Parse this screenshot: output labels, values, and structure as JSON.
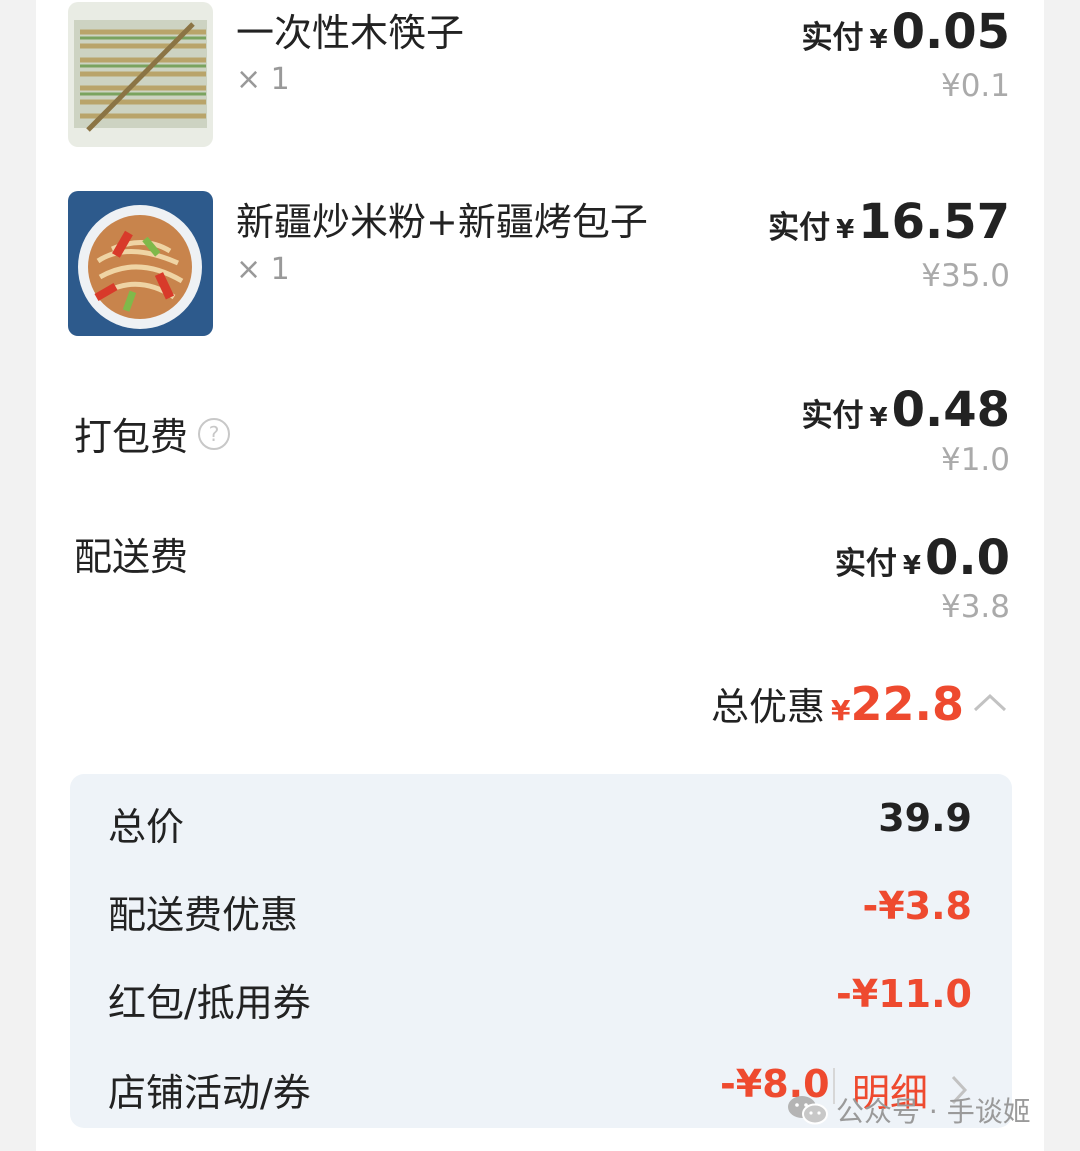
{
  "items": [
    {
      "name": "一次性木筷子",
      "quantity": "× 1",
      "paid_label": "实付",
      "currency": "¥",
      "paid_amount": "0.05",
      "original_price": "¥0.1"
    },
    {
      "name": "新疆炒米粉+新疆烤包子",
      "quantity": "× 1",
      "paid_label": "实付",
      "currency": "¥",
      "paid_amount": "16.57",
      "original_price": "¥35.0"
    }
  ],
  "fees": {
    "packing": {
      "label": "打包费",
      "help_icon_glyph": "?",
      "paid_label": "实付",
      "currency": "¥",
      "paid_amount": "0.48",
      "original_price": "¥1.0"
    },
    "delivery": {
      "label": "配送费",
      "paid_label": "实付",
      "currency": "¥",
      "paid_amount": "0.0",
      "original_price": "¥3.8"
    }
  },
  "total_discount": {
    "label": "总优惠",
    "currency": "¥",
    "amount": "22.8",
    "icon": "chevron-up-icon"
  },
  "summary": {
    "total_price_label": "总价",
    "total_price_value": "39.9",
    "delivery_discount_label": "配送费优惠",
    "delivery_discount_value": "-¥3.8",
    "coupon_label": "红包/抵用券",
    "coupon_value": "-¥11.0",
    "shop_activity_label": "店铺活动/券",
    "shop_activity_value": "-¥8.0",
    "detail_link": "明细"
  },
  "watermark": {
    "text": "公众号 · 手谈姬",
    "icon": "wechat-icon"
  },
  "colors": {
    "accent_red": "#ee4a2f",
    "summary_bg": "#eef3f8",
    "muted_text": "#aaaaaa"
  }
}
